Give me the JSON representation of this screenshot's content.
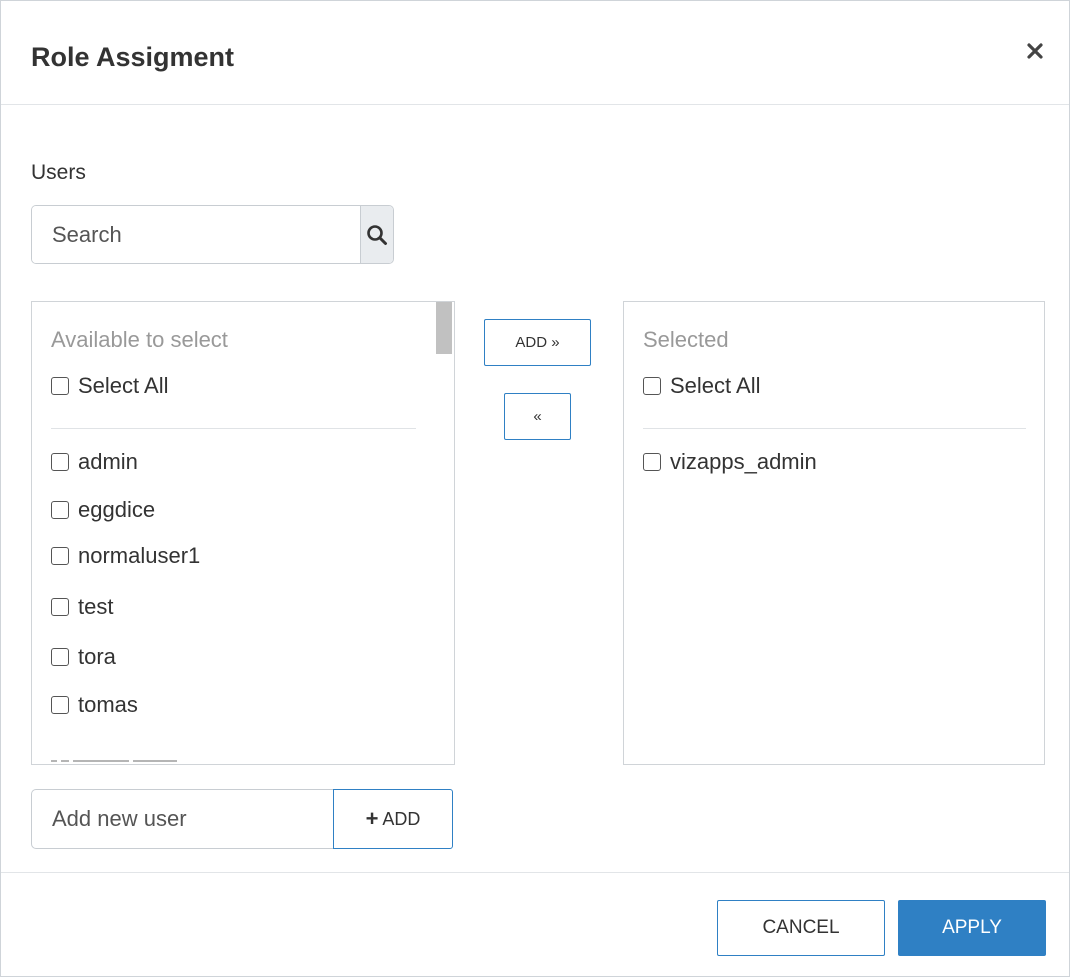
{
  "dialog": {
    "title": "Role Assigment",
    "close_icon": "close-icon"
  },
  "users": {
    "section_label": "Users",
    "search": {
      "placeholder": "Search",
      "value": "",
      "icon": "search-icon"
    }
  },
  "available": {
    "heading": "Available to select",
    "select_all_label": "Select All",
    "items": [
      {
        "label": "admin",
        "checked": false
      },
      {
        "label": "eggdice",
        "checked": false
      },
      {
        "label": "normaluser1",
        "checked": false
      },
      {
        "label": "test",
        "checked": false
      },
      {
        "label": "tora",
        "checked": false
      },
      {
        "label": "tomas",
        "checked": false
      }
    ]
  },
  "move_buttons": {
    "add_label": "ADD »",
    "remove_label": "«"
  },
  "selected": {
    "heading": "Selected",
    "select_all_label": "Select All",
    "items": [
      {
        "label": "vizapps_admin",
        "checked": false
      }
    ]
  },
  "add_user": {
    "placeholder": "Add new user",
    "value": "",
    "button_label": "ADD",
    "button_icon": "plus-icon"
  },
  "footer": {
    "cancel_label": "CANCEL",
    "apply_label": "APPLY"
  },
  "colors": {
    "accent": "#2f80c4",
    "muted_text": "#999999",
    "border": "#d0d4d8"
  }
}
